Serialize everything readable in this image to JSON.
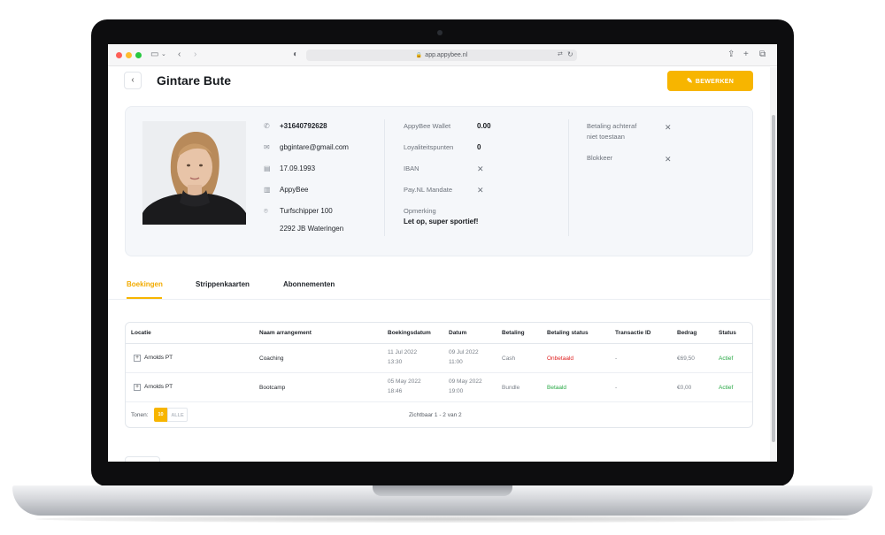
{
  "browser": {
    "url": "app.appybee.nl"
  },
  "header": {
    "back_label": "‹",
    "title": "Gintare Bute",
    "edit_label": "BEWERKEN"
  },
  "profile": {
    "phone": "+31640792628",
    "email": "gbgintare@gmail.com",
    "birthdate": "17.09.1993",
    "company": "AppyBee",
    "street": "Turfschipper 100",
    "city": "2292 JB Wateringen",
    "wallet_label": "AppyBee Wallet",
    "wallet_value": "0.00",
    "loyalty_label": "Loyaliteitspunten",
    "loyalty_value": "0",
    "iban_label": "IBAN",
    "mandate_label": "Pay.NL Mandate",
    "remark_label": "Opmerking",
    "remark_value": "Let op, super sportief!",
    "payment_after_line1": "Betaling achteraf",
    "payment_after_line2": "niet toestaan",
    "block_label": "Blokkeer"
  },
  "tabs": [
    {
      "label": "Boekingen",
      "active": true
    },
    {
      "label": "Strippenkaarten",
      "active": false
    },
    {
      "label": "Abonnementen",
      "active": false
    }
  ],
  "table": {
    "headers": [
      "Locatie",
      "Naam arrangement",
      "Boekingsdatum",
      "Datum",
      "Betaling",
      "Betaling status",
      "Transactie ID",
      "Bedrag",
      "Status"
    ],
    "rows": [
      {
        "location": "Arnolds PT",
        "arrangement": "Coaching",
        "booking_date": "11 Jul 2022",
        "booking_time": "13:30",
        "date": "09 Jul 2022",
        "time": "11:00",
        "payment": "Cash",
        "payment_status": "Onbetaald",
        "transaction_id": "-",
        "amount": "€69,50",
        "status": "Actief"
      },
      {
        "location": "Arnolds PT",
        "arrangement": "Bootcamp",
        "booking_date": "05 May 2022",
        "booking_time": "18:46",
        "date": "09 May 2022",
        "time": "19:00",
        "payment": "Bundle",
        "payment_status": "Betaald",
        "transaction_id": "-",
        "amount": "€0,00",
        "status": "Actief"
      }
    ],
    "show_label": "Tonen:",
    "page_size_10": "10",
    "page_size_all": "ALLE",
    "visible_text": "Zichtbaar 1 - 2 van 2"
  },
  "colors": {
    "accent": "#f7b500",
    "unpaid": "#e02020",
    "paid": "#27a844"
  }
}
